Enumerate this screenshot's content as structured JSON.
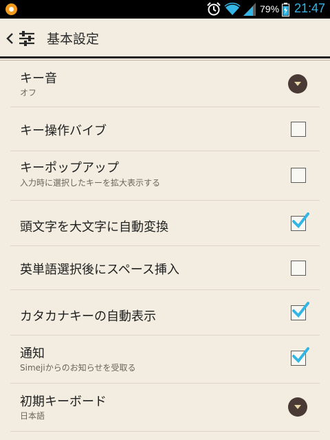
{
  "status_bar": {
    "battery_percent": "79%",
    "time": "21:47",
    "time_color": "#33b5e5",
    "icons": [
      "app-notification-icon",
      "alarm-icon",
      "wifi-icon",
      "signal-icon",
      "battery-icon"
    ]
  },
  "header": {
    "title": "基本設定",
    "icons": [
      "back-chevron-icon",
      "settings-sliders-icon"
    ]
  },
  "settings": [
    {
      "label": "キー音",
      "sub": "オフ",
      "control": "dropdown"
    },
    {
      "label": "キー操作バイブ",
      "sub": "",
      "control": "checkbox",
      "checked": false
    },
    {
      "label": "キーポップアップ",
      "sub": "入力時に選択したキーを拡大表示する",
      "control": "checkbox",
      "checked": false
    },
    {
      "label": "頭文字を大文字に自動変換",
      "sub": "",
      "control": "checkbox",
      "checked": true
    },
    {
      "label": "英単語選択後にスペース挿入",
      "sub": "",
      "control": "checkbox",
      "checked": false
    },
    {
      "label": "カタカナキーの自動表示",
      "sub": "",
      "control": "checkbox",
      "checked": true
    },
    {
      "label": "通知",
      "sub": "Simejiからのお知らせを受取る",
      "control": "checkbox",
      "checked": true
    },
    {
      "label": "初期キーボード",
      "sub": "日本語",
      "control": "dropdown"
    }
  ],
  "colors": {
    "background": "#f2ede0",
    "check_accent": "#33b5e5",
    "dropdown": "#4a3a35"
  }
}
